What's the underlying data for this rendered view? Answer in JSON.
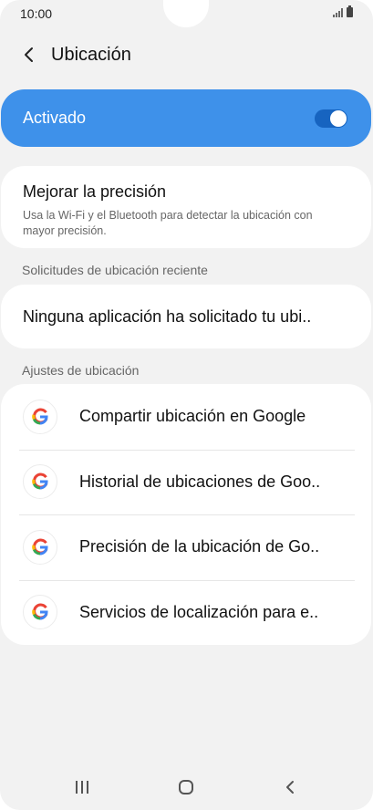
{
  "status_bar": {
    "time": "10:00"
  },
  "header": {
    "title": "Ubicación"
  },
  "master_toggle": {
    "label": "Activado",
    "state": "on",
    "color": "#3e91ea"
  },
  "accuracy": {
    "title": "Mejorar la precisión",
    "description": "Usa la Wi-Fi y el Bluetooth para detectar la ubicación con mayor precisión."
  },
  "recent_requests": {
    "section_title": "Solicitudes de ubicación reciente",
    "text": "Ninguna aplicación ha solicitado tu ubi.."
  },
  "location_settings": {
    "section_title": "Ajustes de ubicación",
    "items": [
      {
        "icon": "google-icon",
        "label": "Compartir ubicación en Google"
      },
      {
        "icon": "google-icon",
        "label": "Historial de ubicaciones de Goo.."
      },
      {
        "icon": "google-icon",
        "label": "Precisión de la ubicación de Go.."
      },
      {
        "icon": "google-icon",
        "label": "Servicios de localización para e.."
      }
    ]
  },
  "nav_bar": {
    "buttons": [
      "recent-apps-icon",
      "home-icon",
      "back-icon"
    ]
  }
}
